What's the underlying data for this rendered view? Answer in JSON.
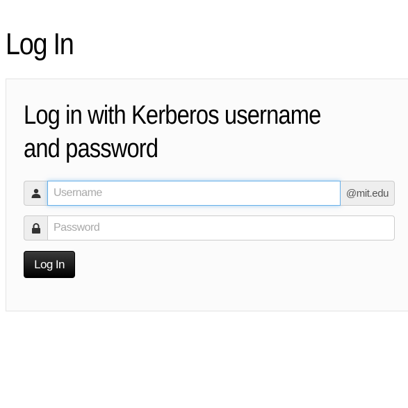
{
  "page": {
    "title": "Log In"
  },
  "login_panel": {
    "heading": "Log in with Kerberos username and password",
    "username": {
      "icon": "user-icon",
      "placeholder": "Username",
      "value": "",
      "suffix": "@mit.edu"
    },
    "password": {
      "icon": "lock-icon",
      "placeholder": "Password",
      "value": ""
    },
    "submit_label": "Log In"
  },
  "colors": {
    "focus_border": "#66afe9",
    "button_background": "#000000",
    "panel_background": "#fbfbfb"
  }
}
